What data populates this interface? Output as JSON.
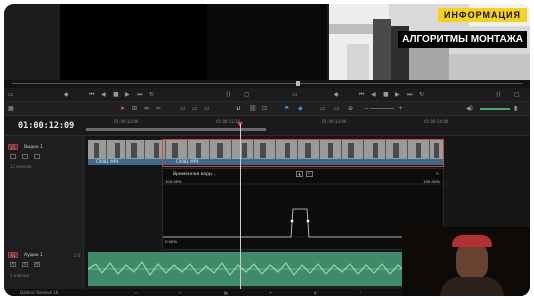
{
  "overlay": {
    "tag_info": "ИНФОРМАЦИЯ",
    "tag_topic": "АЛГОРИТМЫ МОНТАЖА"
  },
  "timeline": {
    "timecode": "01:00:12:09",
    "ruler_ticks": [
      "01:00:12:00",
      "01:00:12:10",
      "01:00:13:00",
      "01:00:14:00"
    ]
  },
  "tracks": {
    "video": {
      "badge": "V1",
      "name": "Видео 1",
      "sub": "12 клипов"
    },
    "audio": {
      "badge": "A1",
      "name": "Аудио 1",
      "channel": "2.0",
      "sub": "1 клипов",
      "mute_letters": [
        "R",
        "S",
        "M"
      ]
    }
  },
  "clips": {
    "clip1_label": "C0081.MP4",
    "clip2_label": "C0081.MP4"
  },
  "curve": {
    "title": "Временная корр...",
    "pct_top_left": "100.00%",
    "pct_top_right": "100.00%",
    "pct_bottom": "0.00%"
  },
  "bottom": {
    "app_name": "DaVinci Resolve 16"
  },
  "icons": {
    "close": "close-icon",
    "play": "play-icon"
  },
  "colors": {
    "clip_label": "#3d6a8a",
    "audio": "#3f8a68",
    "selection": "#d0453c",
    "overlay_yellow": "#f6d31a"
  }
}
